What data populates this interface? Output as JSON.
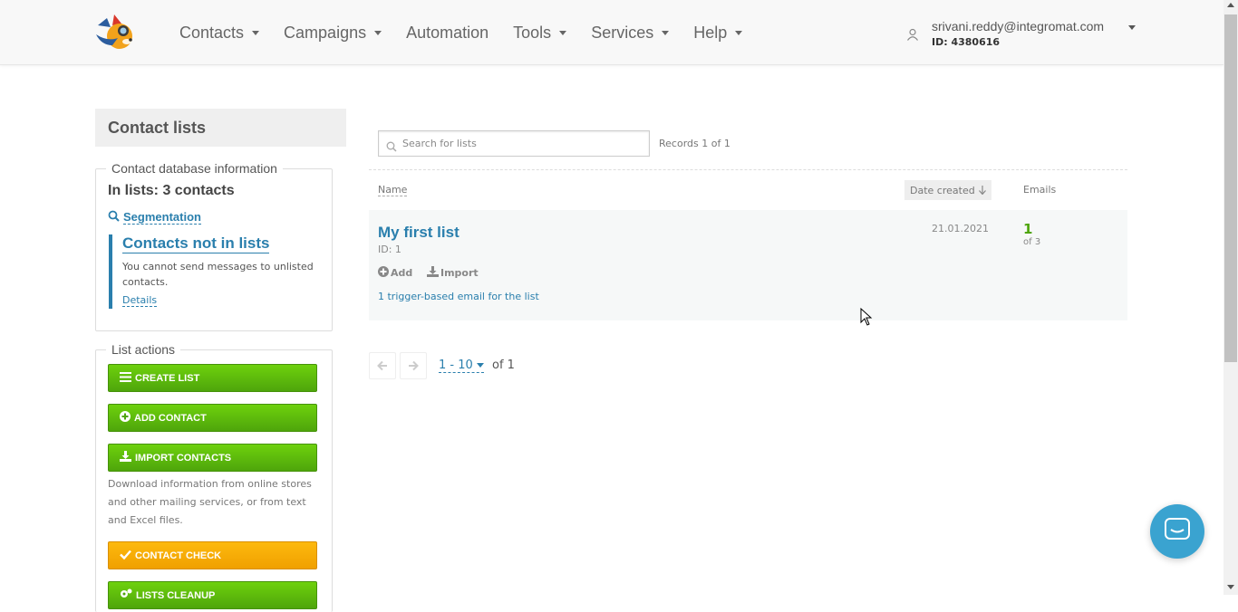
{
  "header": {
    "nav": [
      {
        "label": "Contacts",
        "dropdown": true
      },
      {
        "label": "Campaigns",
        "dropdown": true
      },
      {
        "label": "Automation",
        "dropdown": false
      },
      {
        "label": "Tools",
        "dropdown": true
      },
      {
        "label": "Services",
        "dropdown": true
      },
      {
        "label": "Help",
        "dropdown": true
      }
    ],
    "user": {
      "email": "srivani.reddy@integromat.com",
      "id": "ID: 4380616"
    }
  },
  "sidebar": {
    "title": "Contact lists",
    "db_info": {
      "legend": "Contact database information",
      "in_lists": "In lists: 3 contacts",
      "segmentation": "Segmentation",
      "not_in_lists_title": "Contacts not in lists",
      "not_in_lists_desc": "You cannot send messages to unlisted contacts.",
      "details": "Details"
    },
    "actions": {
      "legend": "List actions",
      "create_list": "CREATE LIST",
      "add_contact": "ADD CONTACT",
      "import_contacts": "IMPORT CONTACTS",
      "import_help": "Download information from online stores and other mailing services, or from text and Excel files.",
      "contact_check": "CONTACT CHECK",
      "lists_cleanup": "LISTS CLEANUP"
    }
  },
  "main": {
    "search_placeholder": "Search for lists",
    "records": "Records 1 of 1",
    "columns": {
      "name": "Name",
      "date_created": "Date created",
      "emails": "Emails"
    },
    "lists": [
      {
        "name": "My first list",
        "id": "ID: 1",
        "add": "Add",
        "import": "Import",
        "trigger": "1 trigger-based email for the list",
        "date": "21.01.2021",
        "emails": "1",
        "emails_of": "of 3"
      }
    ],
    "pagination": {
      "range": "1 - 10",
      "of": "of 1"
    }
  },
  "colors": {
    "accent": "#2a7fad",
    "green": "#4ea50b",
    "orange": "#f0a000",
    "chat": "#3aa3d0"
  }
}
